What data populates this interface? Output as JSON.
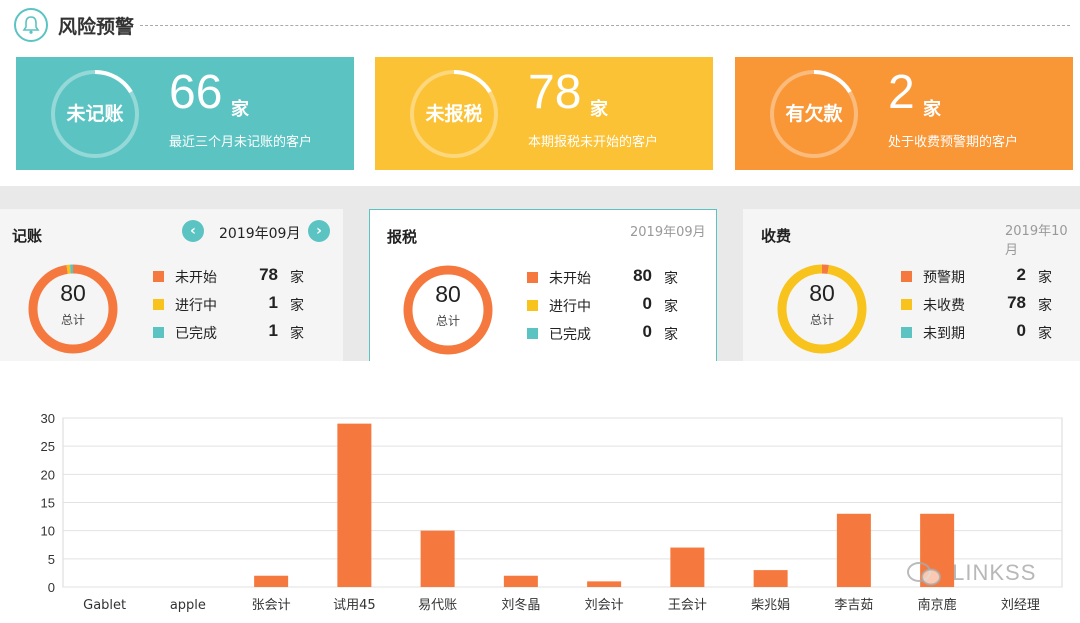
{
  "header": {
    "title": "风险预警",
    "icon": "bell-icon"
  },
  "alerts": [
    {
      "label": "未记账",
      "value": "66",
      "unit": "家",
      "desc": "最近三个月未记账的客户",
      "color": "#5bc4c3"
    },
    {
      "label": "未报税",
      "value": "78",
      "unit": "家",
      "desc": "本期报税未开始的客户",
      "color": "#fbc235"
    },
    {
      "label": "有欠款",
      "value": "2",
      "unit": "家",
      "desc": "处于收费预警期的客户",
      "color": "#f99737"
    }
  ],
  "panels": {
    "bookkeeping": {
      "title": "记账",
      "period": "2019年09月",
      "total": "80",
      "total_label": "总计",
      "items": [
        {
          "name": "未开始",
          "count": "78",
          "unit": "家",
          "color": "#f5793f"
        },
        {
          "name": "进行中",
          "count": "1",
          "unit": "家",
          "color": "#f7c31c"
        },
        {
          "name": "已完成",
          "count": "1",
          "unit": "家",
          "color": "#5bc4c3"
        }
      ]
    },
    "tax": {
      "title": "报税",
      "period": "2019年09月",
      "total": "80",
      "total_label": "总计",
      "items": [
        {
          "name": "未开始",
          "count": "80",
          "unit": "家",
          "color": "#f5793f"
        },
        {
          "name": "进行中",
          "count": "0",
          "unit": "家",
          "color": "#f7c31c"
        },
        {
          "name": "已完成",
          "count": "0",
          "unit": "家",
          "color": "#5bc4c3"
        }
      ]
    },
    "fees": {
      "title": "收费",
      "period": "2019年10月",
      "total": "80",
      "total_label": "总计",
      "items": [
        {
          "name": "预警期",
          "count": "2",
          "unit": "家",
          "color": "#f5793f"
        },
        {
          "name": "未收费",
          "count": "78",
          "unit": "家",
          "color": "#f7c31c"
        },
        {
          "name": "未到期",
          "count": "0",
          "unit": "家",
          "color": "#5bc4c3"
        }
      ]
    }
  },
  "chart_data": {
    "type": "bar",
    "categories": [
      "Gablet",
      "apple",
      "张会计",
      "试用45",
      "易代账",
      "刘冬晶",
      "刘会计",
      "王会计",
      "柴兆娟",
      "李吉茹",
      "南京鹿",
      "刘经理"
    ],
    "values": [
      0,
      0,
      2,
      29,
      10,
      2,
      1,
      7,
      3,
      13,
      13,
      0
    ],
    "ylim": [
      0,
      30
    ],
    "yticks": [
      0,
      5,
      10,
      15,
      20,
      25,
      30
    ],
    "grid": true,
    "bar_color": "#f5793f"
  },
  "watermark": "LINKSS"
}
